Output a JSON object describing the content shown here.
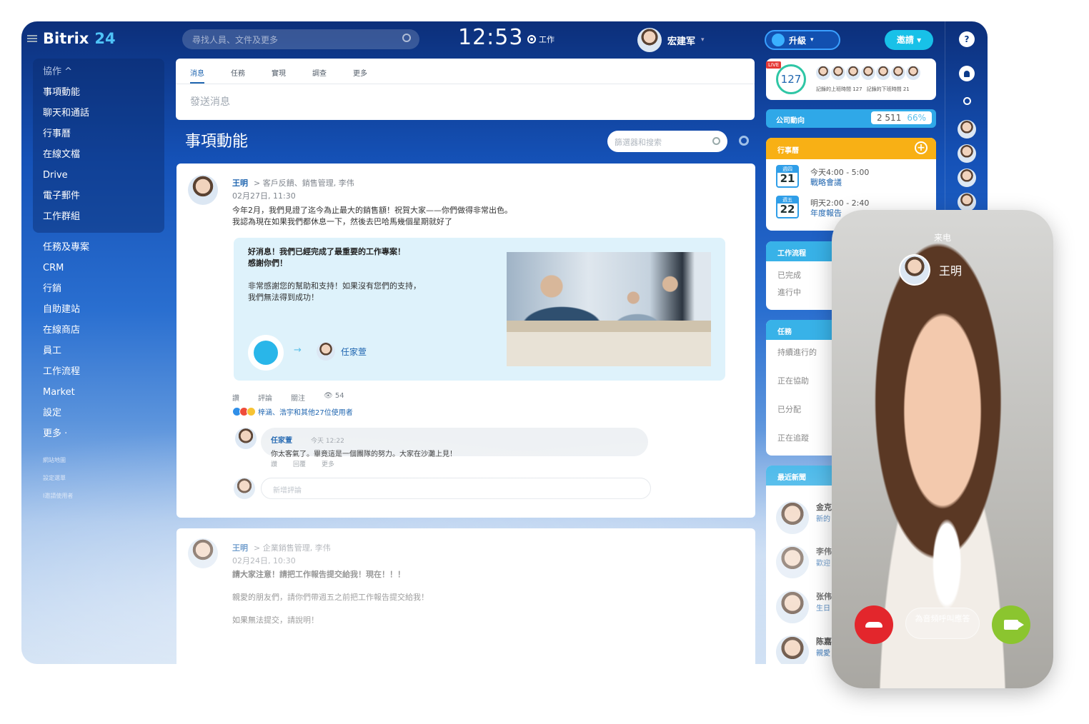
{
  "app": {
    "logo": "Bitrix",
    "logo_num": "24"
  },
  "header": {
    "search_placeholder": "尋找人員、文件及更多",
    "clock": "12:53",
    "work_label": "工作",
    "user_name": "宏建军",
    "upgrade": "升級",
    "invite": "邀請"
  },
  "sidebar": {
    "group_label": "協作 ^",
    "group_items": [
      "事項動能",
      "聊天和通話",
      "行事曆",
      "在線文檔",
      "Drive",
      "電子郵件",
      "工作群組"
    ],
    "items": [
      "任務及專案",
      "CRM",
      "行銷",
      "自助建站",
      "在線商店",
      "員工",
      "工作流程",
      "Market",
      "設定",
      "更多 ·"
    ],
    "small": [
      "網站地圖",
      "設定選單",
      "I邀請使用者"
    ]
  },
  "composer": {
    "tabs": [
      "消息",
      "任務",
      "實現",
      "調查",
      "更多"
    ],
    "placeholder": "發送消息"
  },
  "page": {
    "title": "事項動能",
    "filter_placeholder": "篩選器和搜索"
  },
  "post1": {
    "author": "王明",
    "dest": "> 客戶反饋、銷售管理, 李伟",
    "date": "02月27日, 11:30",
    "text": [
      "今年2月，我們見證了迄今為止最大的銷售額！祝賀大家——你們做得非常出色。",
      "我認為現在如果我們都休息一下，然後去巴哈馬幾個星期就好了"
    ],
    "hl_title": [
      "好消息！我們已經完成了最重要的工作專案！",
      "感謝你們！"
    ],
    "hl_body": [
      "非常感謝您的幫助和支持！如果沒有您們的支持，",
      "我們無法得到成功！"
    ],
    "arrow": "→",
    "recipient": "任家萱",
    "actions": [
      "讚",
      "評論",
      "關注",
      "👁 54"
    ],
    "reactions": "梓涵、浩宇和其他27位使用者",
    "comment": {
      "name": "任家萱",
      "time": "今天 12:22",
      "text": "你太客氣了。畢竟這是一個團隊的努力。大家在沙灘上見！",
      "actions": [
        "讚",
        "回覆",
        "更多"
      ]
    },
    "new_comment": "新增評論"
  },
  "post2": {
    "author": "王明",
    "dest": "> 企業銷售管理, 李伟",
    "date": "02月24日, 10:30",
    "title": "請大家注意！請把工作報告提交給我！現在！！！",
    "lines": [
      "親愛的朋友們，請你們帶週五之前把工作報告提交給我！",
      "如果無法提交，請說明！"
    ]
  },
  "live": {
    "tag": "LIVE",
    "count": "127",
    "txt1": "記錄的上班時間 127",
    "txt2": "記錄的下班時間 21"
  },
  "company": {
    "label": "公司動向",
    "value": "2 511",
    "pct": "66%"
  },
  "calendar": {
    "label": "行事曆",
    "plus": "+",
    "events": [
      {
        "dow": "週四",
        "day": "21",
        "time": "今天4:00 - 5:00",
        "name": "戰略會議"
      },
      {
        "dow": "週五",
        "day": "22",
        "time": "明天2:00 - 2:40",
        "name": "年度報告"
      }
    ]
  },
  "workflow": {
    "label": "工作流程",
    "lines": [
      "已完成",
      "進行中"
    ]
  },
  "tasks": {
    "label": "任務",
    "lines": [
      "持續進行的",
      "正在協助",
      "已分配",
      "正在追蹤"
    ]
  },
  "news": {
    "label": "最近新聞",
    "items": [
      {
        "n1": "金克",
        "n2": "新的"
      },
      {
        "n1": "李伟",
        "n2": "歡迎"
      },
      {
        "n1": "张伟",
        "n2": "生日"
      },
      {
        "n1": "陈嘉",
        "n2": "親愛"
      }
    ]
  },
  "call": {
    "incoming": "来电",
    "caller": "王明",
    "answer_audio": "為音頻呼叫應答"
  },
  "rail": {
    "help": "?"
  },
  "colors": {
    "accent": "#2066b0",
    "brand_blue": "#1552b8",
    "orange": "#f8b015",
    "decline": "#e3262c",
    "video": "#8bc52f"
  }
}
